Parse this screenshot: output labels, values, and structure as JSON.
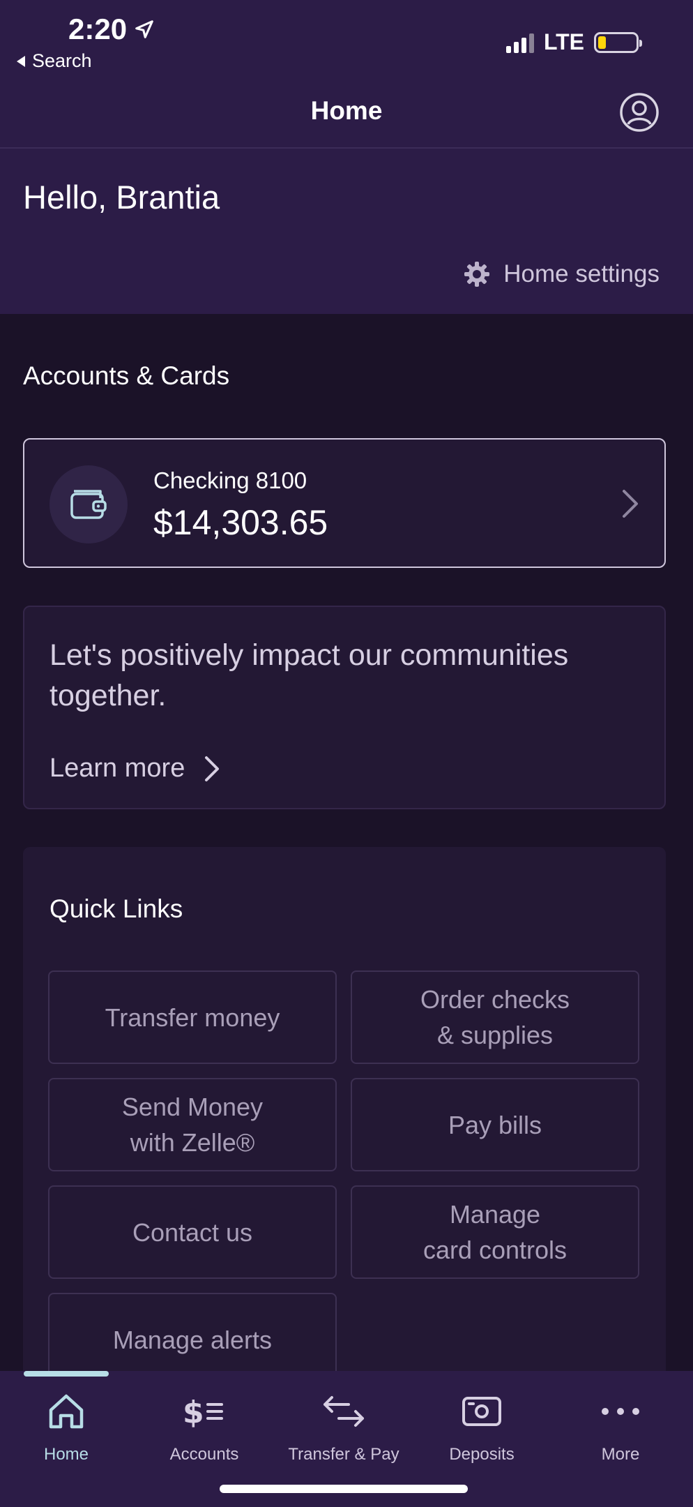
{
  "status_bar": {
    "time": "2:20",
    "back_label": "Search",
    "network": "LTE"
  },
  "header": {
    "title": "Home"
  },
  "greeting": "Hello, Brantia",
  "home_settings_label": "Home settings",
  "accounts_section_title": "Accounts & Cards",
  "account": {
    "name": "Checking 8100",
    "balance": "$14,303.65"
  },
  "promo": {
    "text": "Let's positively impact our communities together.",
    "link_label": "Learn more"
  },
  "quick_links": {
    "title": "Quick Links",
    "items": [
      {
        "label": "Transfer money"
      },
      {
        "label": "Order checks\n& supplies"
      },
      {
        "label": "Send Money\nwith Zelle®"
      },
      {
        "label": "Pay bills"
      },
      {
        "label": "Contact us"
      },
      {
        "label": "Manage\ncard controls"
      },
      {
        "label": "Manage alerts"
      }
    ]
  },
  "tabbar": {
    "items": [
      {
        "label": "Home",
        "icon": "home-icon",
        "active": true
      },
      {
        "label": "Accounts",
        "icon": "accounts-icon"
      },
      {
        "label": "Transfer & Pay",
        "icon": "transfer-icon"
      },
      {
        "label": "Deposits",
        "icon": "deposits-icon"
      },
      {
        "label": "More",
        "icon": "more-icon"
      }
    ]
  },
  "colors": {
    "header_bg": "#2c1c47",
    "page_bg": "#1b1228",
    "card_bg": "#231834",
    "accent": "#b7dde6",
    "battery": "#ffd60a"
  }
}
